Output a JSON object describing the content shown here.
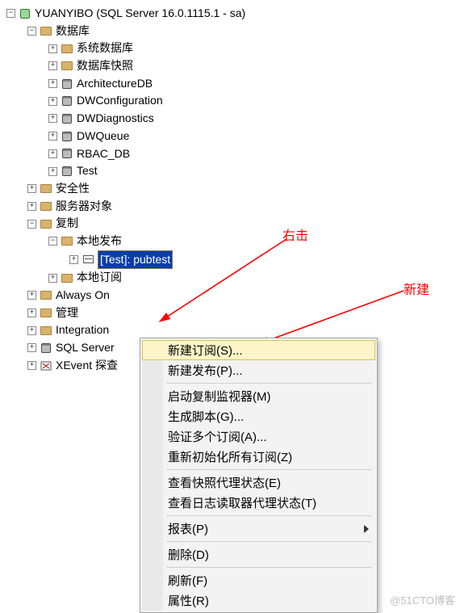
{
  "root": {
    "label": "YUANYIBO (SQL Server 16.0.1115.1 - sa)"
  },
  "databases": {
    "label": "数据库",
    "system": "系统数据库",
    "snapshot": "数据库快照",
    "items": [
      "ArchitectureDB",
      "DWConfiguration",
      "DWDiagnostics",
      "DWQueue",
      "RBAC_DB",
      "Test"
    ]
  },
  "security": "安全性",
  "serverObjects": "服务器对象",
  "replication": {
    "label": "复制",
    "localPublications": "本地发布",
    "selected": "[Test]: pubtest",
    "localSubscriptions": "本地订阅"
  },
  "alwaysOn": "Always On",
  "management": "管理",
  "integration": "Integration",
  "sqlServer": "SQL Server",
  "xevent": "XEvent 探查",
  "annotations": {
    "rightClick": "右击",
    "new": "新建"
  },
  "contextMenu": {
    "newSubscription": "新建订阅(S)...",
    "newPublication": "新建发布(P)...",
    "launchMonitor": "启动复制监视器(M)",
    "generateScripts": "生成脚本(G)...",
    "validateSubs": "验证多个订阅(A)...",
    "reinitAll": "重新初始化所有订阅(Z)",
    "viewSnapshotStatus": "查看快照代理状态(E)",
    "viewLogReaderStatus": "查看日志读取器代理状态(T)",
    "reports": "报表(P)",
    "delete": "删除(D)",
    "refresh": "刷新(F)",
    "properties": "属性(R)"
  },
  "watermark": "@51CTO博客"
}
